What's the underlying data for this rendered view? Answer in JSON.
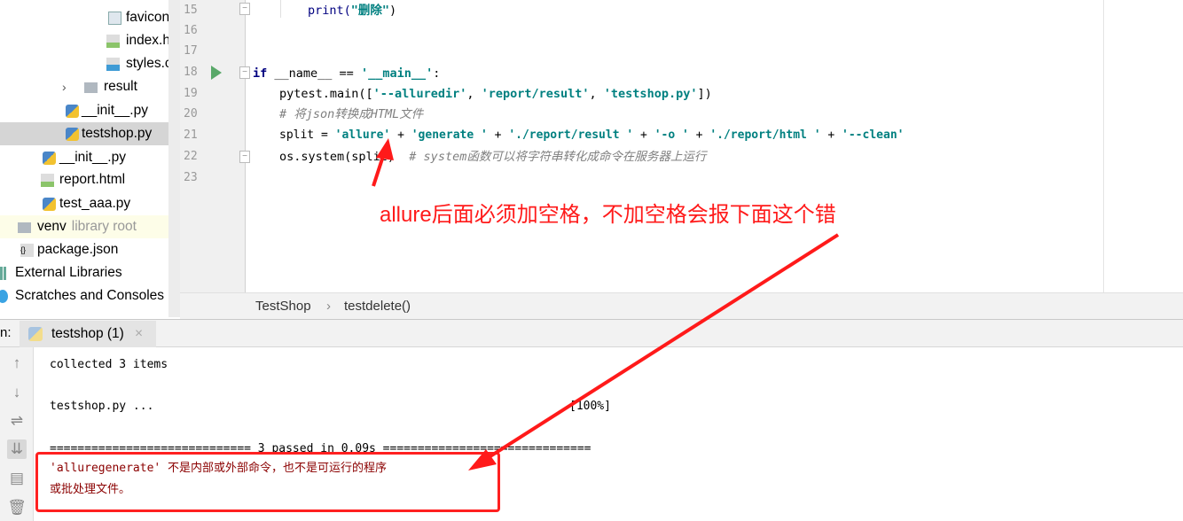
{
  "project_tree": {
    "items": [
      {
        "label": "favicon.ico",
        "icon": "image-file-icon"
      },
      {
        "label": "index.html",
        "icon": "html-file-icon"
      },
      {
        "label": "styles.css",
        "icon": "css-file-icon"
      },
      {
        "label": "result",
        "icon": "folder-icon"
      },
      {
        "label": "__init__.py",
        "icon": "python-file-icon"
      },
      {
        "label": "testshop.py",
        "icon": "python-file-icon",
        "selected": true
      },
      {
        "label": "__init__.py",
        "icon": "python-file-icon"
      },
      {
        "label": "report.html",
        "icon": "html-file-icon"
      },
      {
        "label": "test_aaa.py",
        "icon": "python-file-icon"
      },
      {
        "label": "venv",
        "hint": "library root",
        "icon": "folder-icon"
      },
      {
        "label": "package.json",
        "icon": "json-file-icon"
      },
      {
        "label": "External Libraries",
        "icon": "library-icon"
      },
      {
        "label": "Scratches and Consoles",
        "icon": "scratches-icon"
      }
    ]
  },
  "editor": {
    "line_numbers": [
      "15",
      "16",
      "17",
      "18",
      "19",
      "20",
      "21",
      "22",
      "23"
    ],
    "lines": {
      "l15": [
        "print(",
        "\"删除\"",
        ")"
      ],
      "l18": [
        "if",
        " __name__ == ",
        "'__main__'",
        ":"
      ],
      "l19": [
        "pytest.main([",
        "'--alluredir'",
        ", ",
        "'report/result'",
        ", ",
        "'testshop.py'",
        "])"
      ],
      "l20": [
        "# 将json转换成HTML文件"
      ],
      "l21": [
        "split = ",
        "'allure'",
        " + ",
        "'generate '",
        " + ",
        "'./report/result '",
        " + ",
        "'-o '",
        " + ",
        "'./report/html '",
        " + ",
        "'--clean'"
      ],
      "l22": [
        "os.system(split)",
        "  # system函数可以将字符串转化成命令在服务器上运行"
      ]
    }
  },
  "breadcrumb": {
    "items": [
      "TestShop",
      "testdelete()"
    ],
    "separator": "›"
  },
  "run_panel": {
    "label": "n:",
    "tab_label": "testshop (1)",
    "close": "×",
    "output": {
      "collected": "collected 3 items",
      "test_line": "testshop.py ...",
      "progress": "[100%]",
      "summary": "============================= 3 passed in 0.09s ==============================",
      "error_1": "'alluregenerate' 不是内部或外部命令，也不是可运行的程序",
      "error_2": "或批处理文件。"
    }
  },
  "annotation": {
    "text": "allure后面必须加空格，不加空格会报下面这个错",
    "color": "#ff1a1a"
  }
}
